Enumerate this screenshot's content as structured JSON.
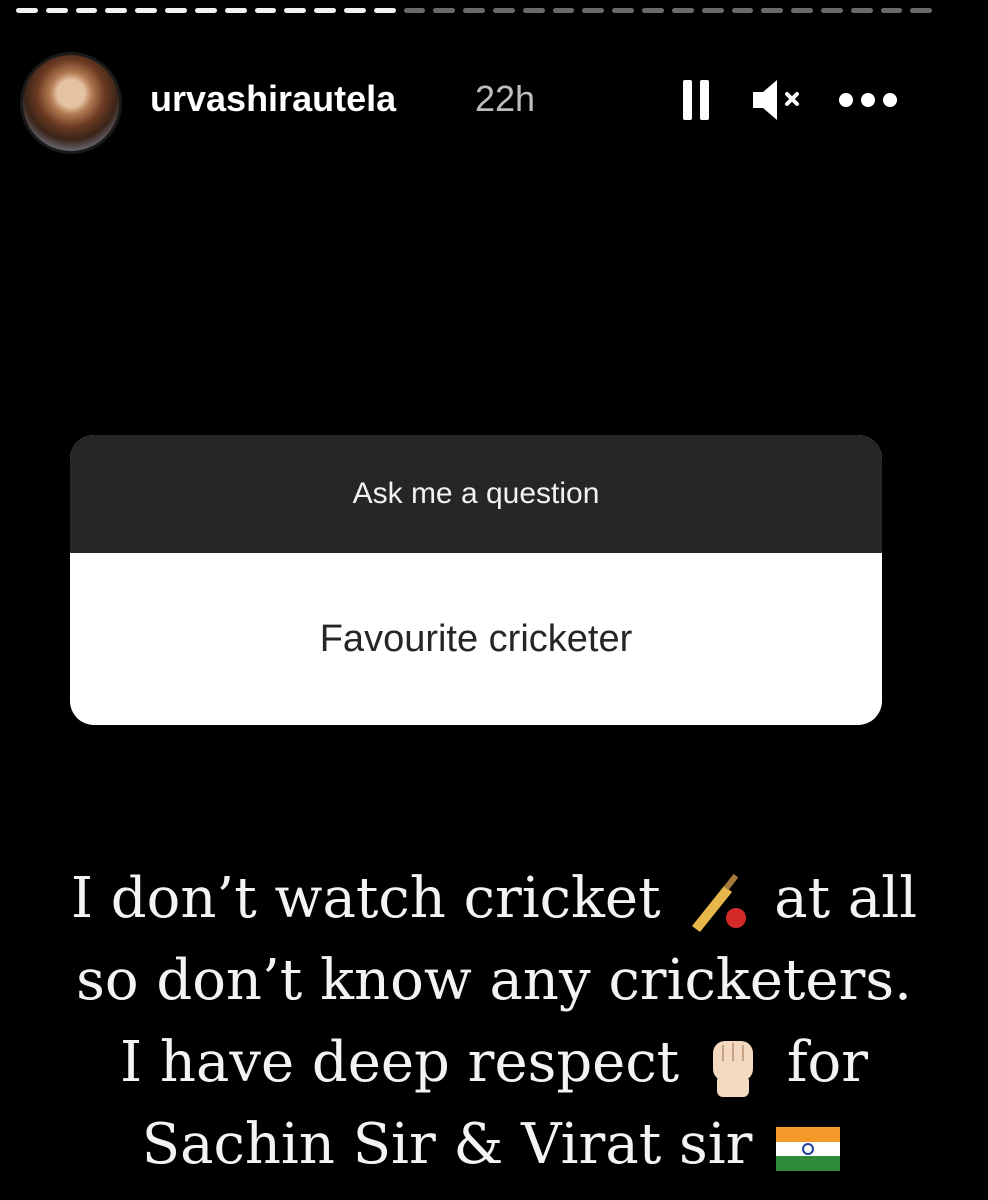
{
  "story": {
    "progress": {
      "segments_viewed": 13,
      "segments_total": 31
    },
    "user": {
      "username": "urvashirautela",
      "time_ago": "22h"
    },
    "controls": {
      "pause_icon": "pause-icon",
      "mute_icon": "speaker-muted-icon",
      "more_icon": "more-dots-icon"
    }
  },
  "question_sticker": {
    "prompt": "Ask me a question",
    "question": "Favourite cricketer"
  },
  "answer_text": {
    "line1_a": "I don’t watch cricket",
    "line1_b": "at all",
    "line2": "so don’t know any cricketers.",
    "line3_a": "I have deep respect",
    "line3_b": "for",
    "line4": "Sachin Sir & Virat sir",
    "emojis": [
      "cricket-bat-ball-icon",
      "raised-fist-icon",
      "india-flag-icon"
    ]
  },
  "colors": {
    "background": "#000000",
    "card_header": "#262626",
    "card_body": "#ffffff"
  }
}
